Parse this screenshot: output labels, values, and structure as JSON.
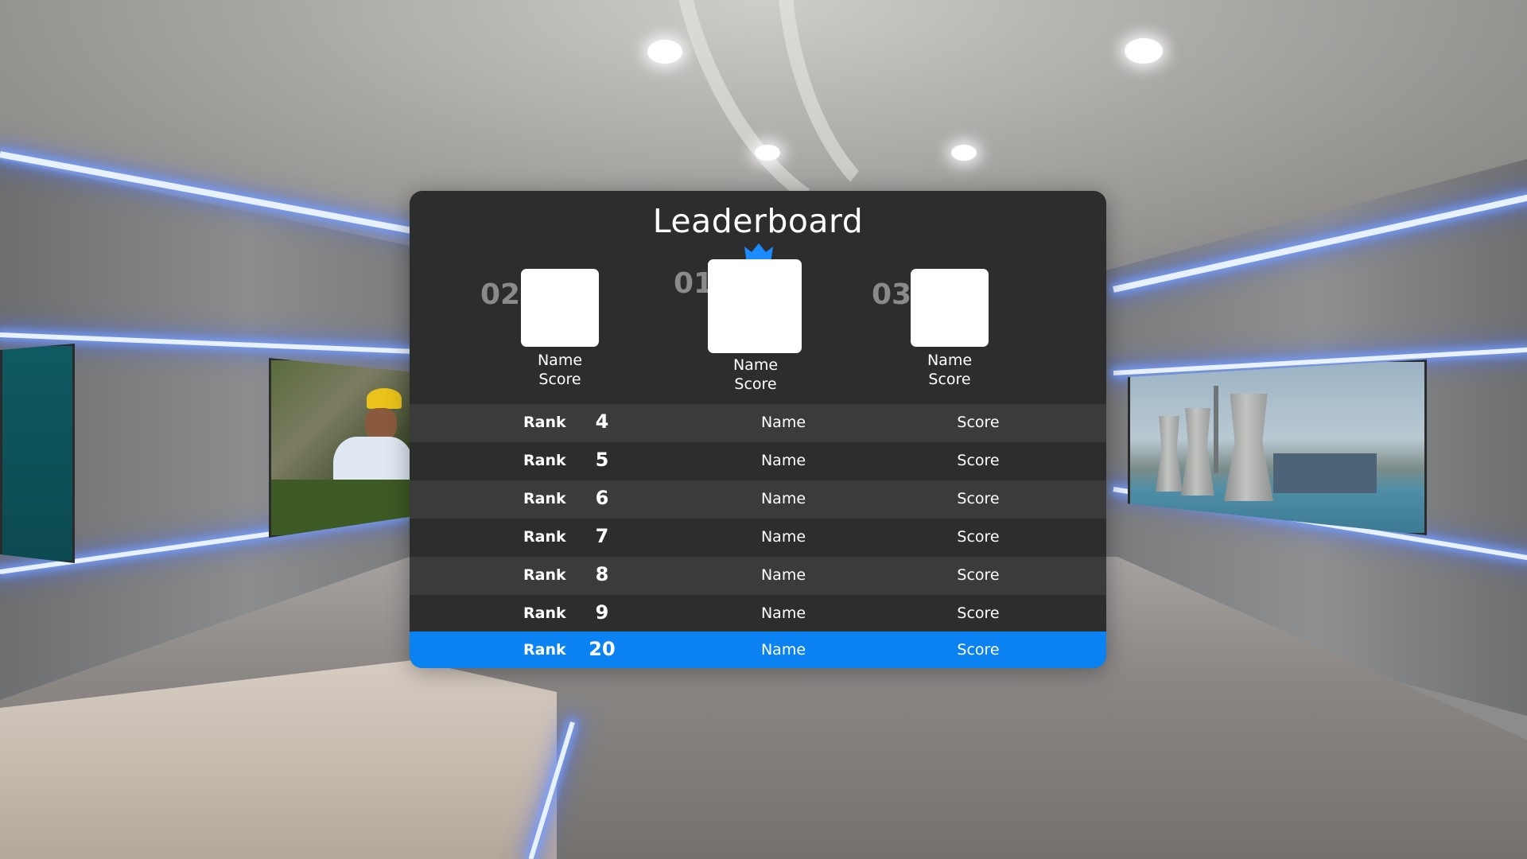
{
  "leaderboard": {
    "title": "Leaderboard",
    "podium": [
      {
        "place_label": "02",
        "name": "Name",
        "score": "Score"
      },
      {
        "place_label": "01",
        "name": "Name",
        "score": "Score"
      },
      {
        "place_label": "03",
        "name": "Name",
        "score": "Score"
      }
    ],
    "rows": [
      {
        "rank_label": "Rank",
        "rank": "4",
        "name": "Name",
        "score": "Score"
      },
      {
        "rank_label": "Rank",
        "rank": "5",
        "name": "Name",
        "score": "Score"
      },
      {
        "rank_label": "Rank",
        "rank": "6",
        "name": "Name",
        "score": "Score"
      },
      {
        "rank_label": "Rank",
        "rank": "7",
        "name": "Name",
        "score": "Score"
      },
      {
        "rank_label": "Rank",
        "rank": "8",
        "name": "Name",
        "score": "Score"
      },
      {
        "rank_label": "Rank",
        "rank": "9",
        "name": "Name",
        "score": "Score"
      },
      {
        "rank_label": "Rank",
        "rank": "20",
        "name": "Name",
        "score": "Score",
        "current_player": true
      }
    ]
  },
  "colors": {
    "panel_bg": "#2d2d2e",
    "row_alt": "#3b3b3c",
    "highlight": "#0b82f2",
    "crown": "#1a8cff",
    "neon": "#9db8ff"
  },
  "icons": {
    "crown": "crown-icon"
  }
}
